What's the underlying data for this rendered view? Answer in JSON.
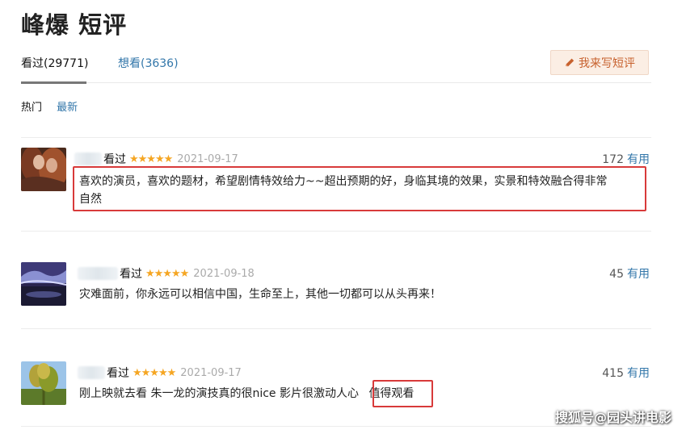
{
  "page": {
    "title": "峰爆 短评"
  },
  "tabs": [
    {
      "label": "看过(29771)",
      "active": true
    },
    {
      "label": "想看(3636)",
      "active": false
    }
  ],
  "write_button": {
    "icon": "pencil-icon",
    "label": "我来写短评"
  },
  "sort": {
    "hot_label": "热门",
    "newest_label": "最新"
  },
  "reviews": [
    {
      "watched_label": "看过",
      "stars": "★★★★★",
      "rating": 5,
      "date": "2021-09-17",
      "votes": "172",
      "useful_label": "有用",
      "comment_line1": "喜欢的演员，喜欢的题材，希望剧情特效给力~~超出预期的好，身临其境的效果，实景和特效融合得非常",
      "comment_line2": "自然"
    },
    {
      "watched_label": "看过",
      "stars": "★★★★★",
      "rating": 5,
      "date": "2021-09-18",
      "votes": "45",
      "useful_label": "有用",
      "comment_line1": "灾难面前，你永远可以相信中国，生命至上，其他一切都可以从头再来！"
    },
    {
      "watched_label": "看过",
      "stars": "★★★★★",
      "rating": 5,
      "date": "2021-09-17",
      "votes": "415",
      "useful_label": "有用",
      "comment_line1": "刚上映就去看 朱一龙的演技真的很nice 影片很激动人心",
      "comment_highlight": "值得观看"
    }
  ],
  "watermark": "搜狐号@园头讲电影",
  "colors": {
    "link": "#3377aa",
    "star": "#f5a623",
    "highlight": "#d83a3a",
    "button_bg": "#fbeee4",
    "button_text": "#c7612e"
  }
}
